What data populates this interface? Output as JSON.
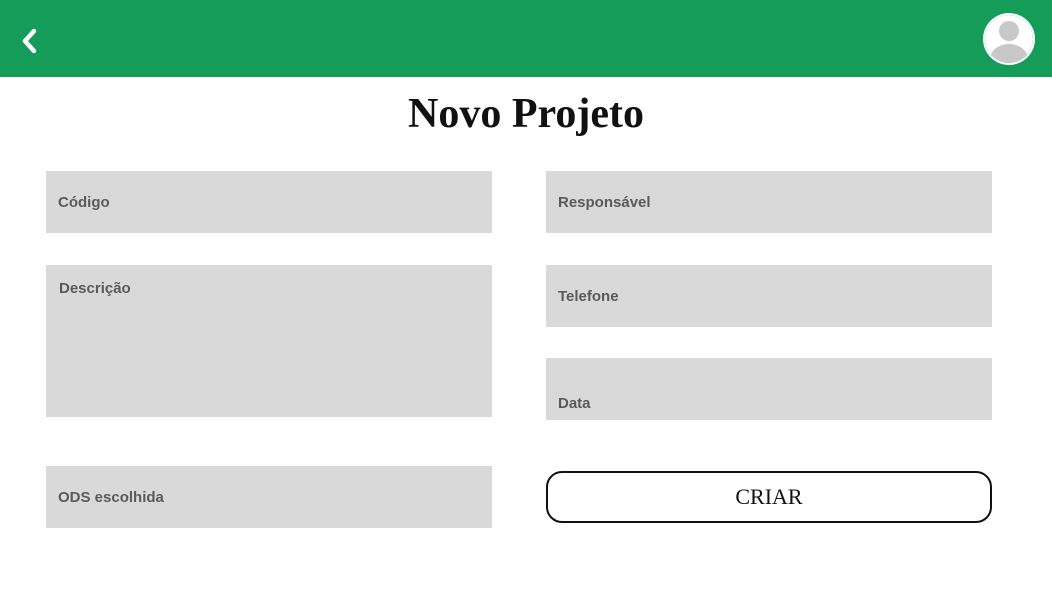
{
  "header": {
    "back_icon": "chevron-left-icon",
    "avatar_icon": "user-avatar-icon",
    "color": "#149c58"
  },
  "page": {
    "title": "Novo Projeto"
  },
  "form": {
    "codigo_placeholder": "Código",
    "descricao_placeholder": "Descrição",
    "ods_placeholder": "ODS escolhida",
    "responsavel_placeholder": "Responsável",
    "telefone_placeholder": "Telefone",
    "data_placeholder": "Data",
    "submit_label": "CRIAR",
    "field_color": "#d9d9d9"
  }
}
